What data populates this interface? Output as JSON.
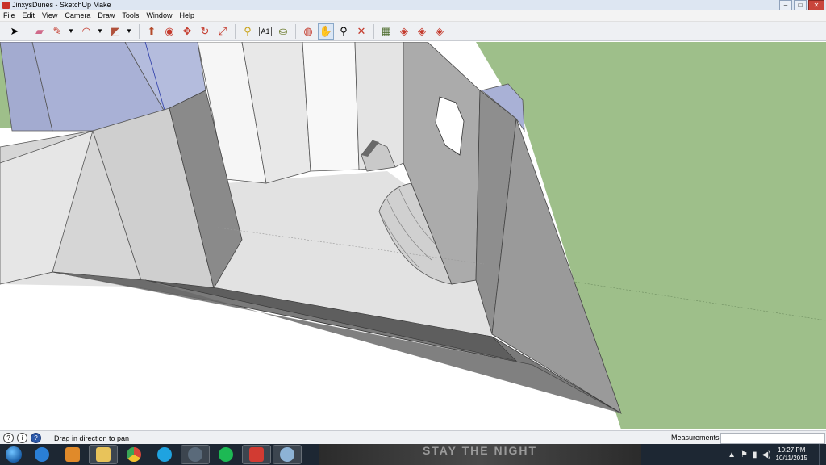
{
  "window": {
    "title": "JinxysDunes - SketchUp Make"
  },
  "menu": {
    "items": [
      "File",
      "Edit",
      "View",
      "Camera",
      "Draw",
      "Tools",
      "Window",
      "Help"
    ]
  },
  "toolbar": {
    "tools": [
      {
        "name": "select-tool-button",
        "glyph": "↖",
        "icon": "cursor-arrow-icon"
      },
      {
        "name": "eraser-tool-button",
        "glyph": "▱",
        "icon": "eraser-icon"
      },
      {
        "name": "pencil-tool-button",
        "glyph": "✎",
        "icon": "pencil-icon"
      },
      {
        "name": "arc-tool-button",
        "glyph": "◠",
        "icon": "arc-icon"
      },
      {
        "name": "shapes-tool-button",
        "glyph": "◩",
        "icon": "rectangle-icon"
      },
      {
        "name": "push-pull-tool-button",
        "glyph": "⬆",
        "icon": "push-pull-icon"
      },
      {
        "name": "follow-me-tool-button",
        "glyph": "◉",
        "icon": "follow-me-icon"
      },
      {
        "name": "move-tool-button",
        "glyph": "✥",
        "icon": "move-icon"
      },
      {
        "name": "rotate-tool-button",
        "glyph": "↻",
        "icon": "rotate-icon"
      },
      {
        "name": "scale-tool-button",
        "glyph": "⤢",
        "icon": "scale-icon"
      },
      {
        "name": "tape-measure-tool-button",
        "glyph": "⚲",
        "icon": "tape-measure-icon"
      },
      {
        "name": "text-tool-button",
        "glyph": "A",
        "icon": "text-icon"
      },
      {
        "name": "paint-bucket-tool-button",
        "glyph": "⛀",
        "icon": "paint-bucket-icon"
      },
      {
        "name": "orbit-tool-button",
        "glyph": "◍",
        "icon": "orbit-icon"
      },
      {
        "name": "pan-tool-button",
        "glyph": "✋",
        "icon": "hand-pan-icon"
      },
      {
        "name": "zoom-tool-button",
        "glyph": "⚲",
        "icon": "magnifier-icon"
      },
      {
        "name": "zoom-extents-tool-button",
        "glyph": "✕",
        "icon": "zoom-extents-icon"
      },
      {
        "name": "get-models-button",
        "glyph": "▦",
        "icon": "warehouse-icon"
      },
      {
        "name": "share-model-button",
        "glyph": "◈",
        "icon": "share-model-icon"
      },
      {
        "name": "share-component-button",
        "glyph": "◈",
        "icon": "share-component-icon"
      },
      {
        "name": "extension-warehouse-button",
        "glyph": "◈",
        "icon": "extension-warehouse-icon"
      }
    ],
    "active_tool": "pan"
  },
  "status": {
    "hint": "Drag in direction to pan",
    "measurements_label": "Measurements",
    "measurements_value": ""
  },
  "taskbar": {
    "apps": [
      {
        "name": "ie-taskbar-button",
        "icon": "internet-explorer-icon",
        "color": "#2a7fd6"
      },
      {
        "name": "media-taskbar-button",
        "icon": "media-player-icon",
        "color": "#e08a2a"
      },
      {
        "name": "explorer-taskbar-button",
        "icon": "folder-icon",
        "color": "#e8c35a"
      },
      {
        "name": "chrome-taskbar-button",
        "icon": "chrome-icon",
        "color": "#d8473a"
      },
      {
        "name": "skype-taskbar-button",
        "icon": "skype-icon",
        "color": "#1fa3e0"
      },
      {
        "name": "camera-taskbar-button",
        "icon": "camera-icon",
        "color": "#5a6a7a"
      },
      {
        "name": "spotify-taskbar-button",
        "icon": "spotify-icon",
        "color": "#1db954"
      },
      {
        "name": "sketchup-taskbar-button",
        "icon": "sketchup-icon",
        "color": "#d23b32"
      },
      {
        "name": "paint-taskbar-button",
        "icon": "paint-palette-icon",
        "color": "#8db3d6"
      }
    ],
    "banner": "STAY THE NIGHT",
    "clock_time": "10:27 PM",
    "clock_date": "10/11/2015"
  },
  "colors": {
    "ground": "#9ebf8a",
    "sky": "#ffffff",
    "wall_light": "#e8e8e8",
    "wall_dark": "#8a8a8a",
    "selection": "#a9b1d6"
  }
}
